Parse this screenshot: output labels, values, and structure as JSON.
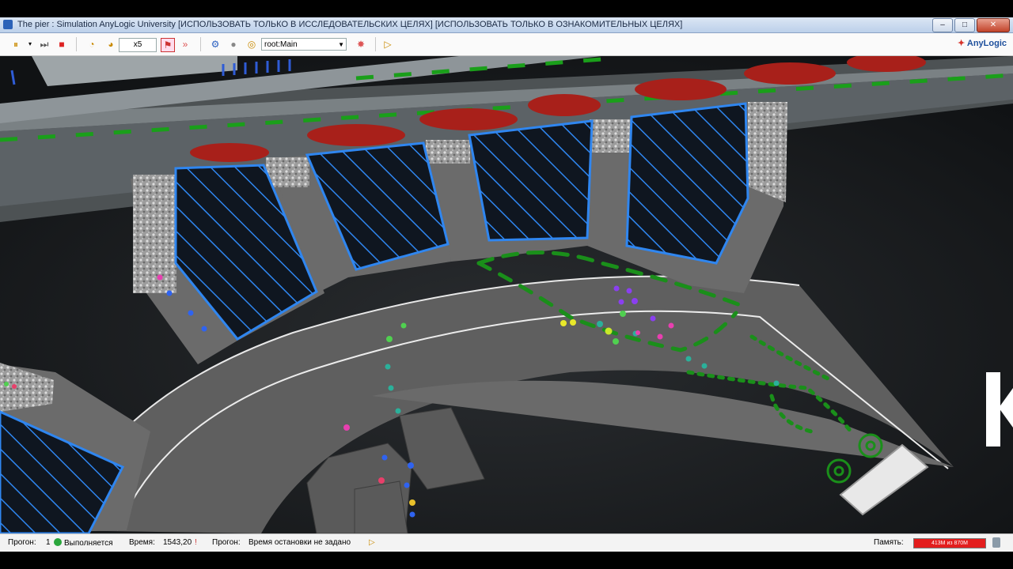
{
  "window": {
    "title": "The pier : Simulation   AnyLogic University  [ИСПОЛЬЗОВАТЬ ТОЛЬКО В ИССЛЕДОВАТЕЛЬСКИХ ЦЕЛЯХ]  [ИСПОЛЬЗОВАТЬ ТОЛЬКО В ОЗНАКОМИТЕЛЬНЫХ ЦЕЛЯХ]",
    "minimize_icon": "minimize-icon",
    "maximize_icon": "maximize-icon",
    "close_icon": "close-icon"
  },
  "toolbar": {
    "speed_value": "x5",
    "navigation_value": "root:Main",
    "brand": "AnyLogic",
    "icons": [
      "run-pause-icon",
      "step-icon",
      "stop-icon",
      "slower-icon",
      "faster-icon",
      "realtime-icon",
      "virtual-time-icon",
      "model-explorer-icon",
      "camera-icon",
      "navigate-icon",
      "experiment-icon",
      "next-icon"
    ]
  },
  "status": {
    "run_label": "Прогон:",
    "run_value": "1",
    "state_value": "Выполняется",
    "time_label": "Время:",
    "time_value": "1543,20",
    "stop_label": "Прогон:",
    "stop_value": "Время остановки не задано",
    "memory_label": "Память:",
    "memory_value": "413M из 870M"
  },
  "colors": {
    "hatch": "#2f86f0",
    "path_green": "#1a8f1a",
    "pier": "#6f6f6f",
    "water": "#16181a",
    "memory_bar": "#e31d1d"
  }
}
